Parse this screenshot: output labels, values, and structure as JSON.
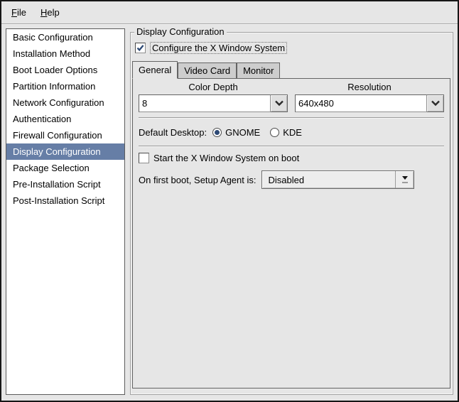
{
  "colors": {
    "window_bg": "#e6e6e6",
    "selection": "#667ea6",
    "mark": "#2d4975"
  },
  "menubar": {
    "items": [
      {
        "label": "File"
      },
      {
        "label": "Help"
      }
    ]
  },
  "sidebar": {
    "items": [
      "Basic Configuration",
      "Installation Method",
      "Boot Loader Options",
      "Partition Information",
      "Network Configuration",
      "Authentication",
      "Firewall Configuration",
      "Display Configuration",
      "Package Selection",
      "Pre-Installation Script",
      "Post-Installation Script"
    ],
    "selected_index": 7,
    "selected": "Display Configuration"
  },
  "panel": {
    "frame_title": "Display Configuration",
    "configure_x": {
      "label": "Configure the X Window System",
      "checked": true
    },
    "tabs": [
      "General",
      "Video Card",
      "Monitor"
    ],
    "active_tab_index": 0,
    "active_tab": "General",
    "general": {
      "color_depth": {
        "label": "Color Depth",
        "value": "8"
      },
      "resolution": {
        "label": "Resolution",
        "value": "640x480"
      },
      "default_desktop": {
        "label": "Default Desktop:",
        "options": [
          {
            "label": "GNOME",
            "selected": true
          },
          {
            "label": "KDE",
            "selected": false
          }
        ]
      },
      "start_x": {
        "label": "Start the X Window System on boot",
        "checked": false
      },
      "setup_agent": {
        "label": "On first boot, Setup Agent is:",
        "value": "Disabled"
      }
    }
  }
}
